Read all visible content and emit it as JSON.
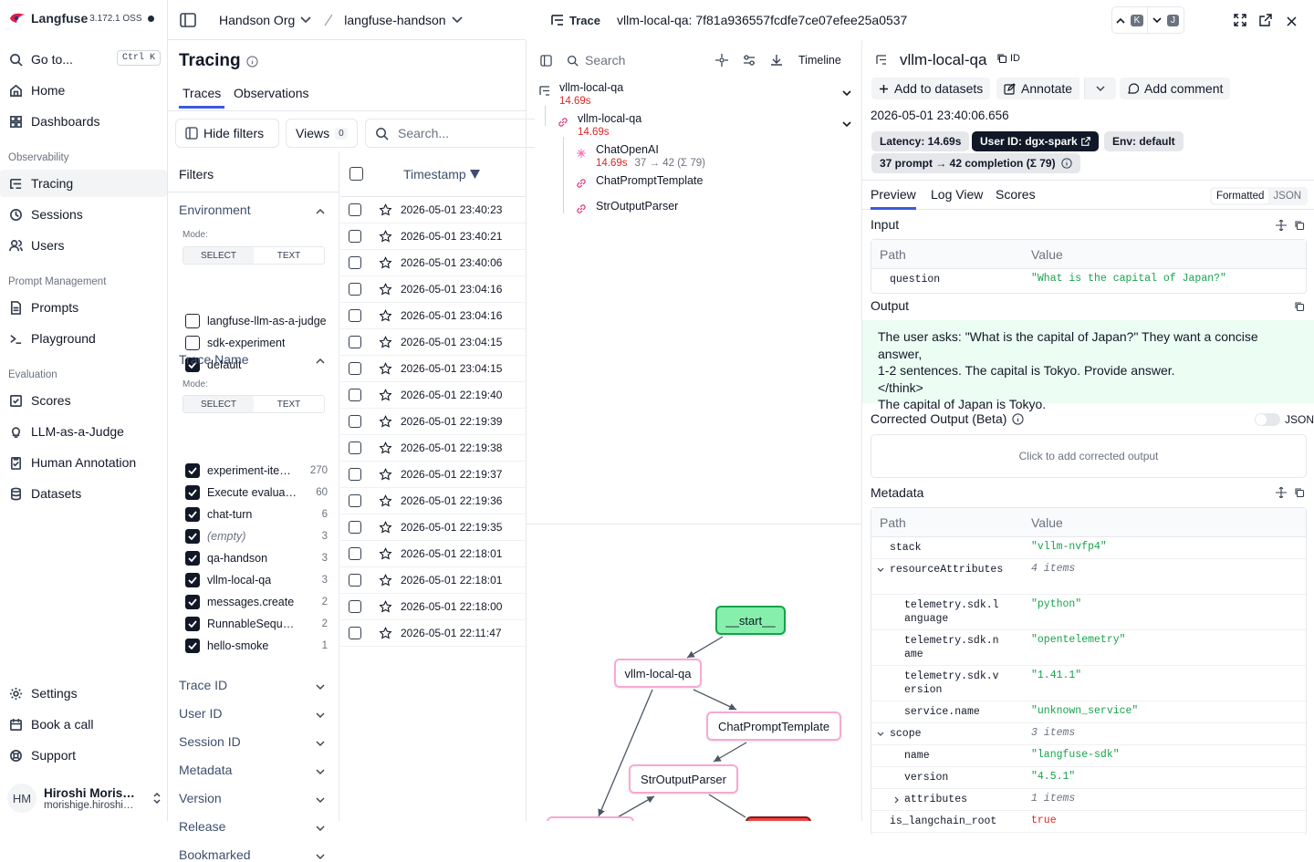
{
  "brand": {
    "name": "Langfuse",
    "version": "3.172.1 OSS"
  },
  "sidebar": {
    "goto": "Go to...",
    "goto_kbd": "Ctrl K",
    "home": "Home",
    "dashboards": "Dashboards",
    "sec_observability": "Observability",
    "tracing": "Tracing",
    "sessions": "Sessions",
    "users": "Users",
    "sec_prompt": "Prompt Management",
    "prompts": "Prompts",
    "playground": "Playground",
    "sec_eval": "Evaluation",
    "scores": "Scores",
    "llm_judge": "LLM-as-a-Judge",
    "human_annotation": "Human Annotation",
    "datasets": "Datasets",
    "settings": "Settings",
    "book_call": "Book a call",
    "support": "Support",
    "user_initials": "HM",
    "user_name": "Hiroshi Moris…",
    "user_email": "morishige.hiroshi…"
  },
  "topbar": {
    "org": "Handson Org",
    "project": "langfuse-handson"
  },
  "page": {
    "title": "Tracing",
    "tab_traces": "Traces",
    "tab_observations": "Observations",
    "hide_filters": "Hide filters",
    "views": "Views",
    "views_count": "0",
    "search_placeholder": "Search..."
  },
  "filters": {
    "title": "Filters",
    "environment": "Environment",
    "mode": "Mode:",
    "select": "SELECT",
    "text": "TEXT",
    "env_options": [
      {
        "label": "langfuse-llm-as-a-judge",
        "checked": false
      },
      {
        "label": "sdk-experiment",
        "checked": false
      },
      {
        "label": "default",
        "checked": true
      }
    ],
    "trace_name": "Trace Name",
    "name_options": [
      {
        "label": "experiment-ite…",
        "count": "270",
        "checked": true
      },
      {
        "label": "Execute evaluat…",
        "count": "60",
        "checked": true
      },
      {
        "label": "chat-turn",
        "count": "6",
        "checked": true
      },
      {
        "label": "(empty)",
        "count": "3",
        "checked": true
      },
      {
        "label": "qa-handson",
        "count": "3",
        "checked": true
      },
      {
        "label": "vllm-local-qa",
        "count": "3",
        "checked": true
      },
      {
        "label": "messages.create",
        "count": "2",
        "checked": true
      },
      {
        "label": "RunnableSeque…",
        "count": "2",
        "checked": true
      },
      {
        "label": "hello-smoke",
        "count": "1",
        "checked": true
      }
    ],
    "collapsed": [
      "Trace ID",
      "User ID",
      "Session ID",
      "Metadata",
      "Version",
      "Release",
      "Bookmarked"
    ]
  },
  "table": {
    "col_timestamp": "Timestamp",
    "rows": [
      "2026-05-01 23:40:23",
      "2026-05-01 23:40:21",
      "2026-05-01 23:40:06",
      "2026-05-01 23:04:16",
      "2026-05-01 23:04:16",
      "2026-05-01 23:04:15",
      "2026-05-01 23:04:15",
      "2026-05-01 22:19:40",
      "2026-05-01 22:19:39",
      "2026-05-01 22:19:38",
      "2026-05-01 22:19:37",
      "2026-05-01 22:19:36",
      "2026-05-01 22:19:35",
      "2026-05-01 22:18:01",
      "2026-05-01 22:18:01",
      "2026-05-01 22:18:00",
      "2026-05-01 22:11:47"
    ]
  },
  "trace": {
    "label": "Trace",
    "id_title": "vllm-local-qa: 7f81a936557fcdfe7ce07efee25a0537",
    "key_up": "K",
    "key_down": "J",
    "search": "Search",
    "timeline": "Timeline",
    "tree": [
      {
        "name": "vllm-local-qa",
        "latency": "14.69s"
      },
      {
        "name": "vllm-local-qa",
        "latency": "14.69s"
      },
      {
        "name": "ChatOpenAI",
        "latency": "14.69s",
        "tokens": "37 → 42 (Σ 79)"
      },
      {
        "name": "ChatPromptTemplate"
      },
      {
        "name": "StrOutputParser"
      }
    ],
    "graph": {
      "start": "__start__",
      "n1": "vllm-local-qa",
      "n2": "ChatPromptTemplate",
      "n3": "StrOutputParser"
    }
  },
  "detail": {
    "name": "vllm-local-qa",
    "id_label": "ID",
    "add_datasets": "Add to datasets",
    "annotate": "Annotate",
    "add_comment": "Add comment",
    "timestamp": "2026-05-01 23:40:06.656",
    "latency": "Latency: 14.69s",
    "user_id": "User ID: dgx-spark",
    "env": "Env: default",
    "tokens": "37 prompt → 42 completion (Σ 79)",
    "tab_preview": "Preview",
    "tab_log": "Log View",
    "tab_scores": "Scores",
    "formatted": "Formatted",
    "json": "JSON",
    "input": "Input",
    "path": "Path",
    "value": "Value",
    "input_key": "question",
    "input_val": "\"What is the capital of Japan?\"",
    "output": "Output",
    "output_lines": [
      "The user asks: \"What is the capital of Japan?\" They want a concise answer,",
      "1-2 sentences. The capital is Tokyo. Provide answer.",
      "</think>",
      "The capital of Japan is Tokyo."
    ],
    "corrected": "Corrected Output (Beta)",
    "corrected_json": "JSON",
    "corrected_placeholder": "Click to add corrected output",
    "metadata": "Metadata",
    "meta_rows": [
      {
        "k": "stack",
        "v": "\"vllm-nvfp4\"",
        "type": "s"
      },
      {
        "k": "resourceAttributes",
        "v": "4 items",
        "type": "i"
      },
      {
        "k": "telemetry.sdk.language",
        "v": "\"python\"",
        "type": "s"
      },
      {
        "k": "telemetry.sdk.name",
        "v": "\"opentelemetry\"",
        "type": "s"
      },
      {
        "k": "telemetry.sdk.version",
        "v": "\"1.41.1\"",
        "type": "s"
      },
      {
        "k": "service.name",
        "v": "\"unknown_service\"",
        "type": "s"
      },
      {
        "k": "scope",
        "v": "3 items",
        "type": "i"
      },
      {
        "k": "name",
        "v": "\"langfuse-sdk\"",
        "type": "s"
      },
      {
        "k": "version",
        "v": "\"4.5.1\"",
        "type": "s"
      },
      {
        "k": "attributes",
        "v": "1 items",
        "type": "i"
      },
      {
        "k": "is_langchain_root",
        "v": "true",
        "type": "r"
      }
    ]
  }
}
